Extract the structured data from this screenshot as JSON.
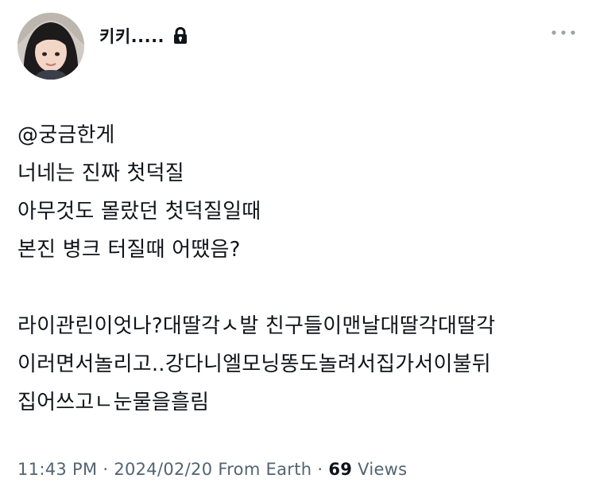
{
  "author": {
    "display_name": "키키.....",
    "protected_icon": "lock-icon",
    "avatar_icon": "profile-photo"
  },
  "menu": {
    "more_icon": "more-dots-icon"
  },
  "tweet": {
    "lines": [
      "@궁금한게",
      "너네는 진짜 첫덕질",
      "아무것도 몰랐던 첫덕질일때",
      "본진 병크 터질때 어땠음?",
      "",
      "라이관린이엇나?대딸각ㅅ발 친구들이맨날대딸각대딸각",
      "이러면서놀리고..강다니엘모닝똥도놀려서집가서이불뒤",
      "집어쓰고ㄴ눈물을흘림"
    ]
  },
  "meta": {
    "time": "11:43 PM",
    "separator1": " · ",
    "date": "2024/02/20",
    "source": " From Earth",
    "separator2": " · ",
    "views_count": "69",
    "views_label": " Views"
  },
  "colors": {
    "text": "#0f1419",
    "muted": "#536471",
    "background": "#ffffff"
  }
}
